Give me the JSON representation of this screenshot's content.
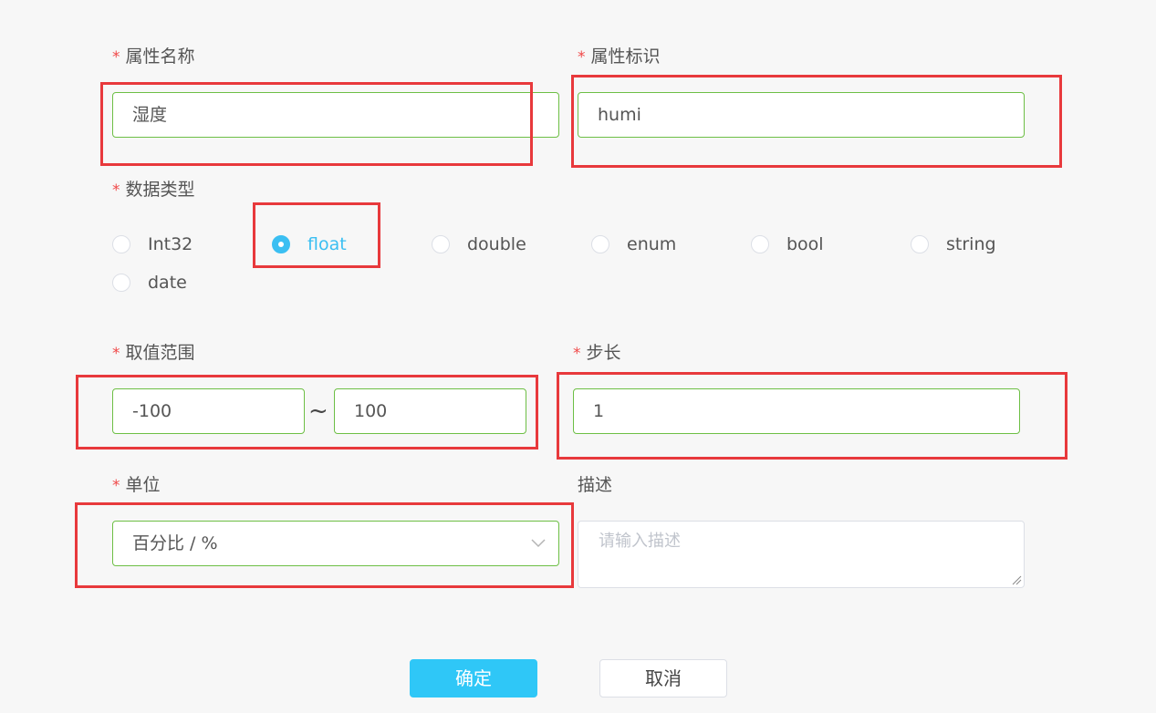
{
  "form": {
    "required_mark": "*",
    "attr_name": {
      "label": "属性名称",
      "value": "湿度"
    },
    "attr_id": {
      "label": "属性标识",
      "value": "humi"
    },
    "data_type": {
      "label": "数据类型",
      "options": [
        "Int32",
        "float",
        "double",
        "enum",
        "bool",
        "string",
        "date"
      ],
      "selected": "float"
    },
    "range": {
      "label": "取值范围",
      "min": "-100",
      "separator": "~",
      "max": "100"
    },
    "step": {
      "label": "步长",
      "value": "1"
    },
    "unit": {
      "label": "单位",
      "value": "百分比 / %",
      "icon": "chevron-down-icon"
    },
    "description": {
      "label": "描述",
      "placeholder": "请输入描述",
      "icon": "resize-handle-icon"
    }
  },
  "actions": {
    "confirm_label": "确定",
    "cancel_label": "取消"
  },
  "colors": {
    "accent": "#2fc7f7",
    "valid_border": "#6dbf45",
    "required": "#f04848",
    "annotation": "#e8393c"
  }
}
